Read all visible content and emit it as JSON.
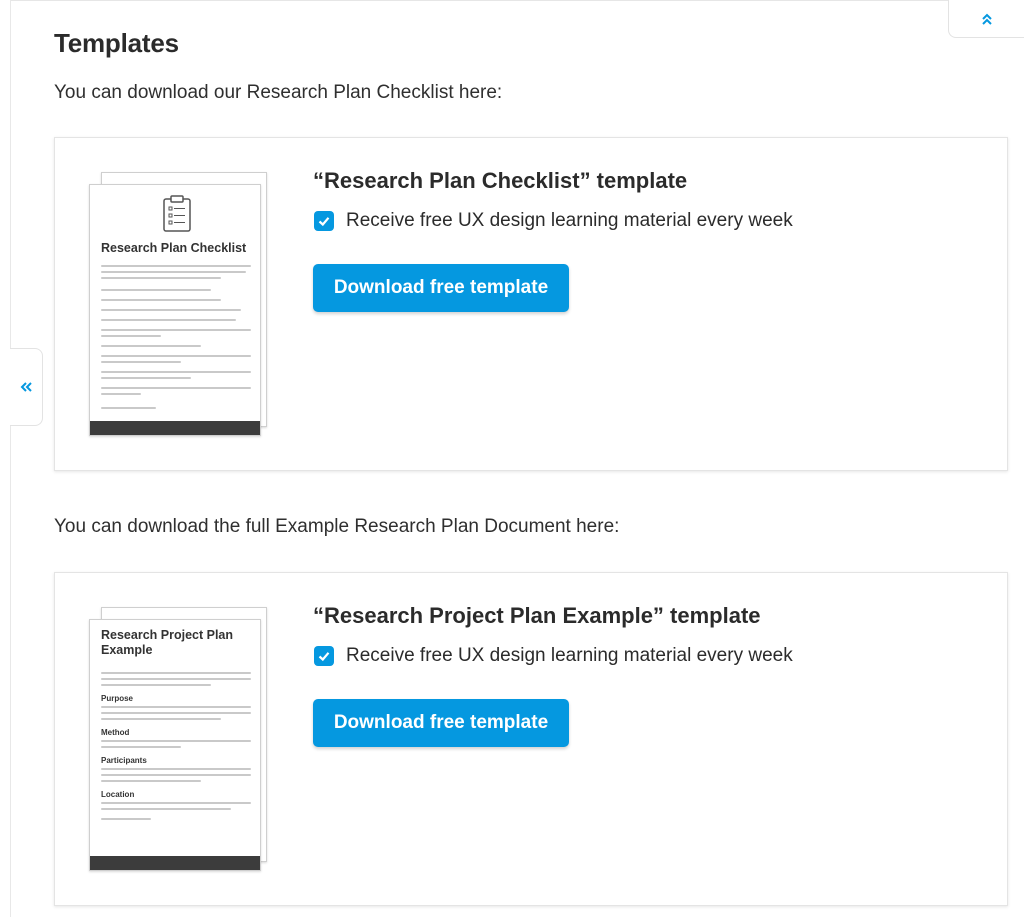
{
  "page": {
    "heading": "Templates",
    "intro_checklist": "You can download our Research Plan Checklist here:",
    "intro_example": "You can download the full Example Research Plan Document here:"
  },
  "controls": {
    "scroll_top_icon": "double-chevron-up-icon",
    "collapse_icon": "double-chevron-left-icon"
  },
  "cards": [
    {
      "title": "“Research Plan Checklist” template",
      "thumbnail_title": "Research Plan Checklist",
      "consent_label": "Receive free UX design learning material every week",
      "consent_checked": true,
      "button_label": "Download free template"
    },
    {
      "title": "“Research Project Plan Example” template",
      "thumbnail_title": "Research Project Plan Example",
      "thumbnail_sections": [
        "Purpose",
        "Method",
        "Participants",
        "Location"
      ],
      "consent_label": "Receive free UX design learning material every week",
      "consent_checked": true,
      "button_label": "Download free template"
    }
  ],
  "colors": {
    "accent": "#0598e0",
    "text": "#2b2b2b",
    "border": "#e4e4e4"
  }
}
